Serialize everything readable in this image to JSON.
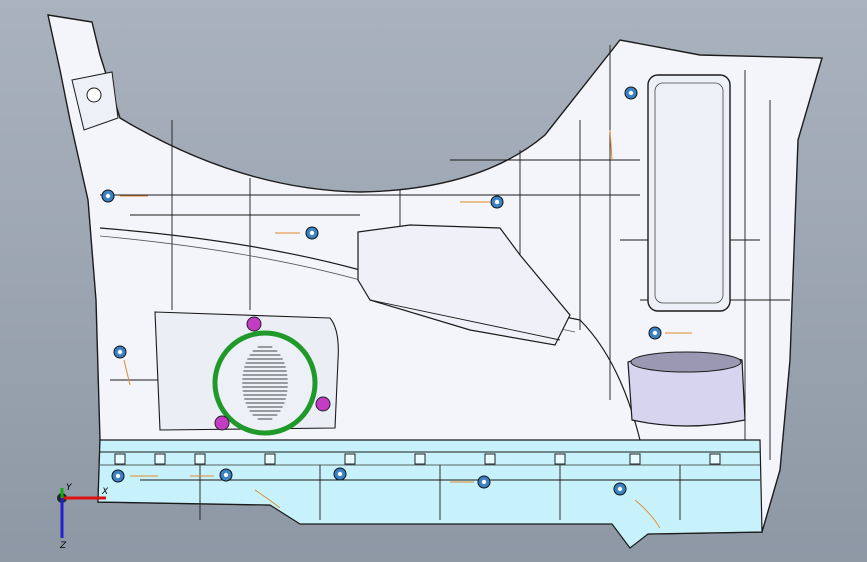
{
  "viewport": {
    "background_top": "#a9b2bd",
    "background_bottom": "#8e98a5"
  },
  "model": {
    "panel_fill": "#f4f5fb",
    "panel_edge": "#1b1b1b",
    "sill_fill": "#c7f2fb",
    "speaker_ring_color": "#1f9a2a",
    "speaker_clip_color": "#c43cc4",
    "fastener_color": "#3a82c4",
    "centerline_color": "#e08a2a"
  },
  "triad": {
    "x_label": "X",
    "y_label": "Y",
    "z_label": "Z",
    "x_color": "#d11",
    "y_color": "#1a1",
    "z_color": "#22c"
  }
}
